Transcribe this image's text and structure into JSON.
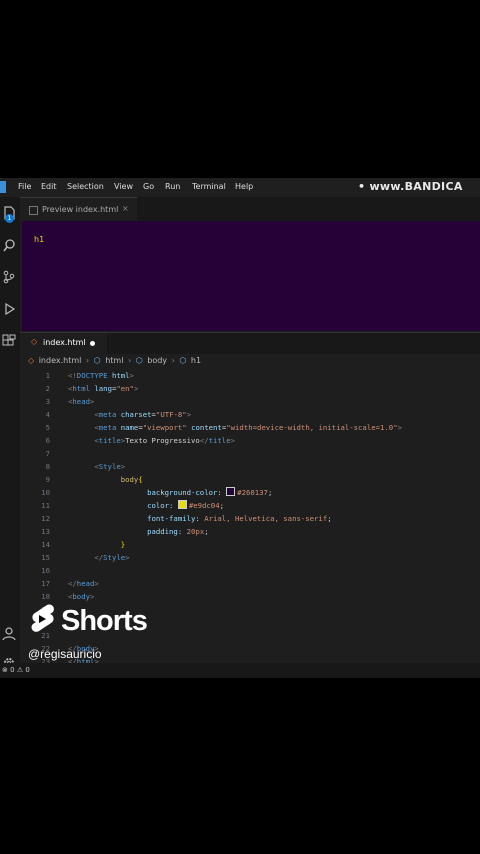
{
  "menubar": {
    "items": [
      "File",
      "Edit",
      "Selection",
      "View",
      "Go",
      "Run",
      "Terminal",
      "Help"
    ],
    "watermark": "• www.BANDICA"
  },
  "activity_bar": {
    "explorer_badge": "1",
    "settings_badge": "1"
  },
  "preview_tab": {
    "label": "Preview index.html",
    "close": "×"
  },
  "preview": {
    "heading": "h1",
    "background": "#260137",
    "color": "#e9dc04"
  },
  "editor_tab": {
    "label": "index.html"
  },
  "breadcrumb": [
    "index.html",
    "html",
    "body",
    "h1"
  ],
  "code_lines": [
    {
      "n": "1",
      "html": "<span class=\"g\">&lt;!</span><span class=\"t\">DOCTYPE</span> <span class=\"a\">html</span><span class=\"g\">&gt;</span>"
    },
    {
      "n": "2",
      "html": "<span class=\"g\">&lt;</span><span class=\"t\">html</span> <span class=\"a\">lang</span><span class=\"w\">=</span><span class=\"s\">\"en\"</span><span class=\"g\">&gt;</span>"
    },
    {
      "n": "3",
      "html": "<span class=\"g\">&lt;</span><span class=\"t\">head</span><span class=\"g\">&gt;</span>"
    },
    {
      "n": "4",
      "html": "      <span class=\"g\">&lt;</span><span class=\"t\">meta</span> <span class=\"a\">charset</span><span class=\"w\">=</span><span class=\"s\">\"UTF-8\"</span><span class=\"g\">&gt;</span>"
    },
    {
      "n": "5",
      "html": "      <span class=\"g\">&lt;</span><span class=\"t\">meta</span> <span class=\"a\">name</span><span class=\"w\">=</span><span class=\"s\">\"viewport\"</span> <span class=\"a\">content</span><span class=\"w\">=</span><span class=\"s\">\"width=device-width, initial-scale=1.0\"</span><span class=\"g\">&gt;</span>"
    },
    {
      "n": "6",
      "html": "      <span class=\"g\">&lt;</span><span class=\"t\">title</span><span class=\"g\">&gt;</span><span class=\"w\">Texto Progressivo</span><span class=\"g\">&lt;/</span><span class=\"t\">title</span><span class=\"g\">&gt;</span>"
    },
    {
      "n": "7",
      "html": ""
    },
    {
      "n": "8",
      "html": "      <span class=\"g\">&lt;</span><span class=\"t\">Style</span><span class=\"g\">&gt;</span>"
    },
    {
      "n": "9",
      "html": "            <span class=\"p\">body</span><span class=\"b\">{</span>"
    },
    {
      "n": "10",
      "html": "                  <span class=\"pr\">background-color</span><span class=\"w\">: </span><span class=\"swatch\" style=\"background:#260137\"></span><span class=\"v\">#260137</span><span class=\"w\">;</span>"
    },
    {
      "n": "11",
      "html": "                  <span class=\"pr\">color</span><span class=\"w\">: </span><span class=\"swatch\" style=\"background:#e9dc04\"></span><span class=\"v\">#e9dc04</span><span class=\"w\">;</span>"
    },
    {
      "n": "12",
      "html": "                  <span class=\"pr\">font-family</span><span class=\"w\">: </span><span class=\"v\">Arial, Helvetica, sans-serif</span><span class=\"w\">;</span>"
    },
    {
      "n": "13",
      "html": "                  <span class=\"pr\">padding</span><span class=\"w\">: </span><span class=\"v\">20px</span><span class=\"w\">;</span>"
    },
    {
      "n": "14",
      "html": "            <span class=\"b\">}</span>"
    },
    {
      "n": "15",
      "html": "      <span class=\"g\">&lt;/</span><span class=\"t\">Style</span><span class=\"g\">&gt;</span>"
    },
    {
      "n": "16",
      "html": ""
    },
    {
      "n": "17",
      "html": "<span class=\"g\">&lt;/</span><span class=\"t\">head</span><span class=\"g\">&gt;</span>"
    },
    {
      "n": "18",
      "html": "<span class=\"g\">&lt;</span><span class=\"t\">body</span><span class=\"g\">&gt;</span>"
    },
    {
      "n": "19",
      "html": ""
    },
    {
      "n": "20",
      "html": ""
    },
    {
      "n": "21",
      "html": ""
    },
    {
      "n": "22",
      "html": "<span class=\"g\">&lt;/</span><span class=\"t\">body</span><span class=\"g\">&gt;</span>"
    },
    {
      "n": "23",
      "html": "<span class=\"g\">&lt;/</span><span class=\"t\">html</span><span class=\"g\">&gt;</span>"
    }
  ],
  "status": {
    "errors": "0",
    "warnings": "0"
  },
  "overlay": {
    "shorts_label": "Shorts",
    "handle": "@regisauricio"
  }
}
